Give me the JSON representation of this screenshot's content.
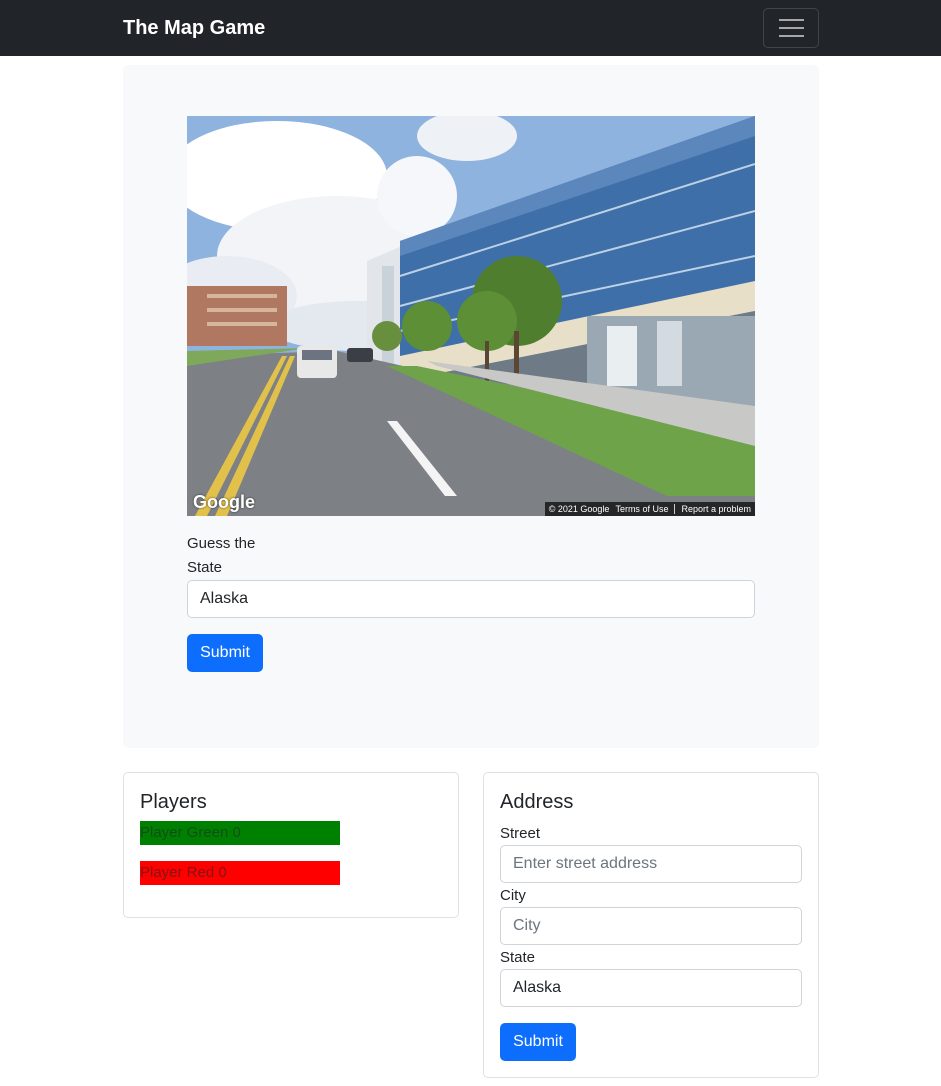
{
  "navbar": {
    "brand": "The Map Game",
    "toggle_icon": "hamburger-icon"
  },
  "street_view": {
    "logo_text": "Google",
    "copyright": "© 2021 Google",
    "terms": "Terms of Use",
    "report": "Report a problem"
  },
  "guess": {
    "label": "Guess the State",
    "value": "Alaska",
    "submit_label": "Submit"
  },
  "players": {
    "title": "Players",
    "items": [
      {
        "label": "Player Green 0",
        "color": "#008000"
      },
      {
        "label": "Player Red 0",
        "color": "#ff0000"
      }
    ]
  },
  "address": {
    "title": "Address",
    "street_label": "Street",
    "street_placeholder": "Enter street address",
    "city_label": "City",
    "city_placeholder": "City",
    "state_label": "State",
    "state_value": "Alaska",
    "submit_label": "Submit"
  },
  "colors": {
    "navbar": "#212529",
    "primary": "#0d6efd",
    "panel": "#f8f9fa"
  }
}
